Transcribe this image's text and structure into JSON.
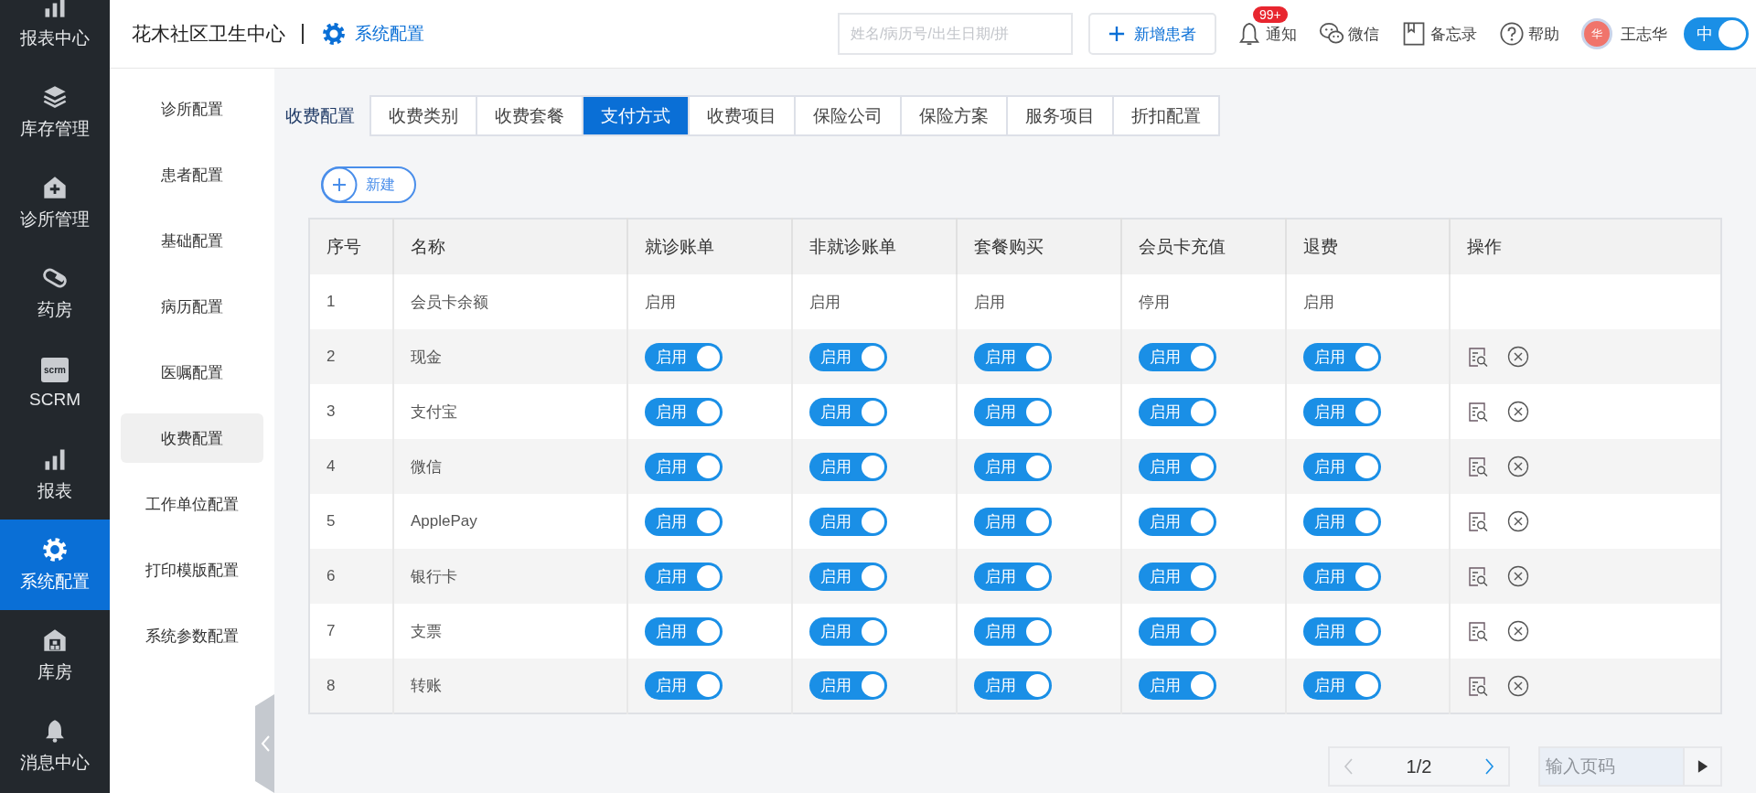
{
  "nav": {
    "items": [
      {
        "label": "报表中心",
        "selected": false
      },
      {
        "label": "库存管理",
        "selected": false
      },
      {
        "label": "诊所管理",
        "selected": false
      },
      {
        "label": "药房",
        "selected": false
      },
      {
        "label": "SCRM",
        "selected": false,
        "icon_text": "scrm"
      },
      {
        "label": "报表",
        "selected": false
      },
      {
        "label": "系统配置",
        "selected": true
      },
      {
        "label": "库房",
        "selected": false
      },
      {
        "label": "消息中心",
        "selected": false
      }
    ]
  },
  "header": {
    "title": "花木社区卫生中心",
    "section": "系统配置",
    "search": {
      "placeholder": "姓名/病历号/出生日期/拼"
    },
    "new_patient": "新增患者",
    "tools": [
      {
        "label": "通知",
        "badge": "99+"
      },
      {
        "label": "微信"
      },
      {
        "label": "备忘录"
      },
      {
        "label": "帮助"
      }
    ],
    "user": {
      "avatar": "华",
      "name": "王志华"
    },
    "lang_toggle": {
      "label": "中",
      "on": true
    }
  },
  "sidebar": {
    "items": [
      {
        "label": "诊所配置",
        "selected": false
      },
      {
        "label": "患者配置",
        "selected": false
      },
      {
        "label": "基础配置",
        "selected": false
      },
      {
        "label": "病历配置",
        "selected": false
      },
      {
        "label": "医嘱配置",
        "selected": false
      },
      {
        "label": "收费配置",
        "selected": true
      },
      {
        "label": "工作单位配置",
        "selected": false
      },
      {
        "label": "打印模版配置",
        "selected": false
      },
      {
        "label": "系统参数配置",
        "selected": false
      }
    ]
  },
  "tabs": {
    "label": "收费配置",
    "items": [
      {
        "label": "收费类别",
        "selected": false
      },
      {
        "label": "收费套餐",
        "selected": false
      },
      {
        "label": "支付方式",
        "selected": true
      },
      {
        "label": "收费项目",
        "selected": false
      },
      {
        "label": "保险公司",
        "selected": false
      },
      {
        "label": "保险方案",
        "selected": false
      },
      {
        "label": "服务项目",
        "selected": false
      },
      {
        "label": "折扣配置",
        "selected": false
      }
    ]
  },
  "new_button": "新建",
  "table": {
    "columns": [
      "序号",
      "名称",
      "就诊账单",
      "非就诊账单",
      "套餐购买",
      "会员卡充值",
      "退费",
      "操作"
    ],
    "rows": [
      {
        "index": "1",
        "name": "会员卡余额",
        "status": [
          {
            "kind": "text",
            "label": "启用"
          },
          {
            "kind": "text",
            "label": "启用"
          },
          {
            "kind": "text",
            "label": "启用"
          },
          {
            "kind": "text",
            "label": "停用"
          },
          {
            "kind": "text",
            "label": "启用"
          }
        ]
      },
      {
        "index": "2",
        "name": "现金",
        "status": [
          {
            "kind": "toggle",
            "label": "启用",
            "on": true
          },
          {
            "kind": "toggle",
            "label": "启用",
            "on": true
          },
          {
            "kind": "toggle",
            "label": "启用",
            "on": true
          },
          {
            "kind": "toggle",
            "label": "启用",
            "on": true
          },
          {
            "kind": "toggle",
            "label": "启用",
            "on": true
          }
        ],
        "actions": [
          {
            "kind": "view"
          },
          {
            "kind": "delete"
          }
        ]
      },
      {
        "index": "3",
        "name": "支付宝",
        "status": [
          {
            "kind": "toggle",
            "label": "启用",
            "on": true
          },
          {
            "kind": "toggle",
            "label": "启用",
            "on": true
          },
          {
            "kind": "toggle",
            "label": "启用",
            "on": true
          },
          {
            "kind": "toggle",
            "label": "启用",
            "on": true
          },
          {
            "kind": "toggle",
            "label": "启用",
            "on": true
          }
        ],
        "actions": [
          {
            "kind": "view"
          },
          {
            "kind": "delete"
          }
        ]
      },
      {
        "index": "4",
        "name": "微信",
        "status": [
          {
            "kind": "toggle",
            "label": "启用",
            "on": true
          },
          {
            "kind": "toggle",
            "label": "启用",
            "on": true
          },
          {
            "kind": "toggle",
            "label": "启用",
            "on": true
          },
          {
            "kind": "toggle",
            "label": "启用",
            "on": true
          },
          {
            "kind": "toggle",
            "label": "启用",
            "on": true
          }
        ],
        "actions": [
          {
            "kind": "view"
          },
          {
            "kind": "delete"
          }
        ]
      },
      {
        "index": "5",
        "name": "ApplePay",
        "status": [
          {
            "kind": "toggle",
            "label": "启用",
            "on": true
          },
          {
            "kind": "toggle",
            "label": "启用",
            "on": true
          },
          {
            "kind": "toggle",
            "label": "启用",
            "on": true
          },
          {
            "kind": "toggle",
            "label": "启用",
            "on": true
          },
          {
            "kind": "toggle",
            "label": "启用",
            "on": true
          }
        ],
        "actions": [
          {
            "kind": "view"
          },
          {
            "kind": "delete"
          }
        ]
      },
      {
        "index": "6",
        "name": "银行卡",
        "status": [
          {
            "kind": "toggle",
            "label": "启用",
            "on": true
          },
          {
            "kind": "toggle",
            "label": "启用",
            "on": true
          },
          {
            "kind": "toggle",
            "label": "启用",
            "on": true
          },
          {
            "kind": "toggle",
            "label": "启用",
            "on": true
          },
          {
            "kind": "toggle",
            "label": "启用",
            "on": true
          }
        ],
        "actions": [
          {
            "kind": "view"
          },
          {
            "kind": "delete"
          }
        ]
      },
      {
        "index": "7",
        "name": "支票",
        "status": [
          {
            "kind": "toggle",
            "label": "启用",
            "on": true
          },
          {
            "kind": "toggle",
            "label": "启用",
            "on": true
          },
          {
            "kind": "toggle",
            "label": "启用",
            "on": true
          },
          {
            "kind": "toggle",
            "label": "启用",
            "on": true
          },
          {
            "kind": "toggle",
            "label": "启用",
            "on": true
          }
        ],
        "actions": [
          {
            "kind": "view"
          },
          {
            "kind": "delete"
          }
        ]
      },
      {
        "index": "8",
        "name": "转账",
        "status": [
          {
            "kind": "toggle",
            "label": "启用",
            "on": true
          },
          {
            "kind": "toggle",
            "label": "启用",
            "on": true
          },
          {
            "kind": "toggle",
            "label": "启用",
            "on": true
          },
          {
            "kind": "toggle",
            "label": "启用",
            "on": true
          },
          {
            "kind": "toggle",
            "label": "启用",
            "on": true
          }
        ],
        "actions": [
          {
            "kind": "view"
          },
          {
            "kind": "delete"
          }
        ]
      }
    ]
  },
  "pagination": {
    "page": "1/2",
    "prev_enabled": false,
    "next_enabled": true,
    "jump": {
      "placeholder": "输入页码"
    }
  }
}
